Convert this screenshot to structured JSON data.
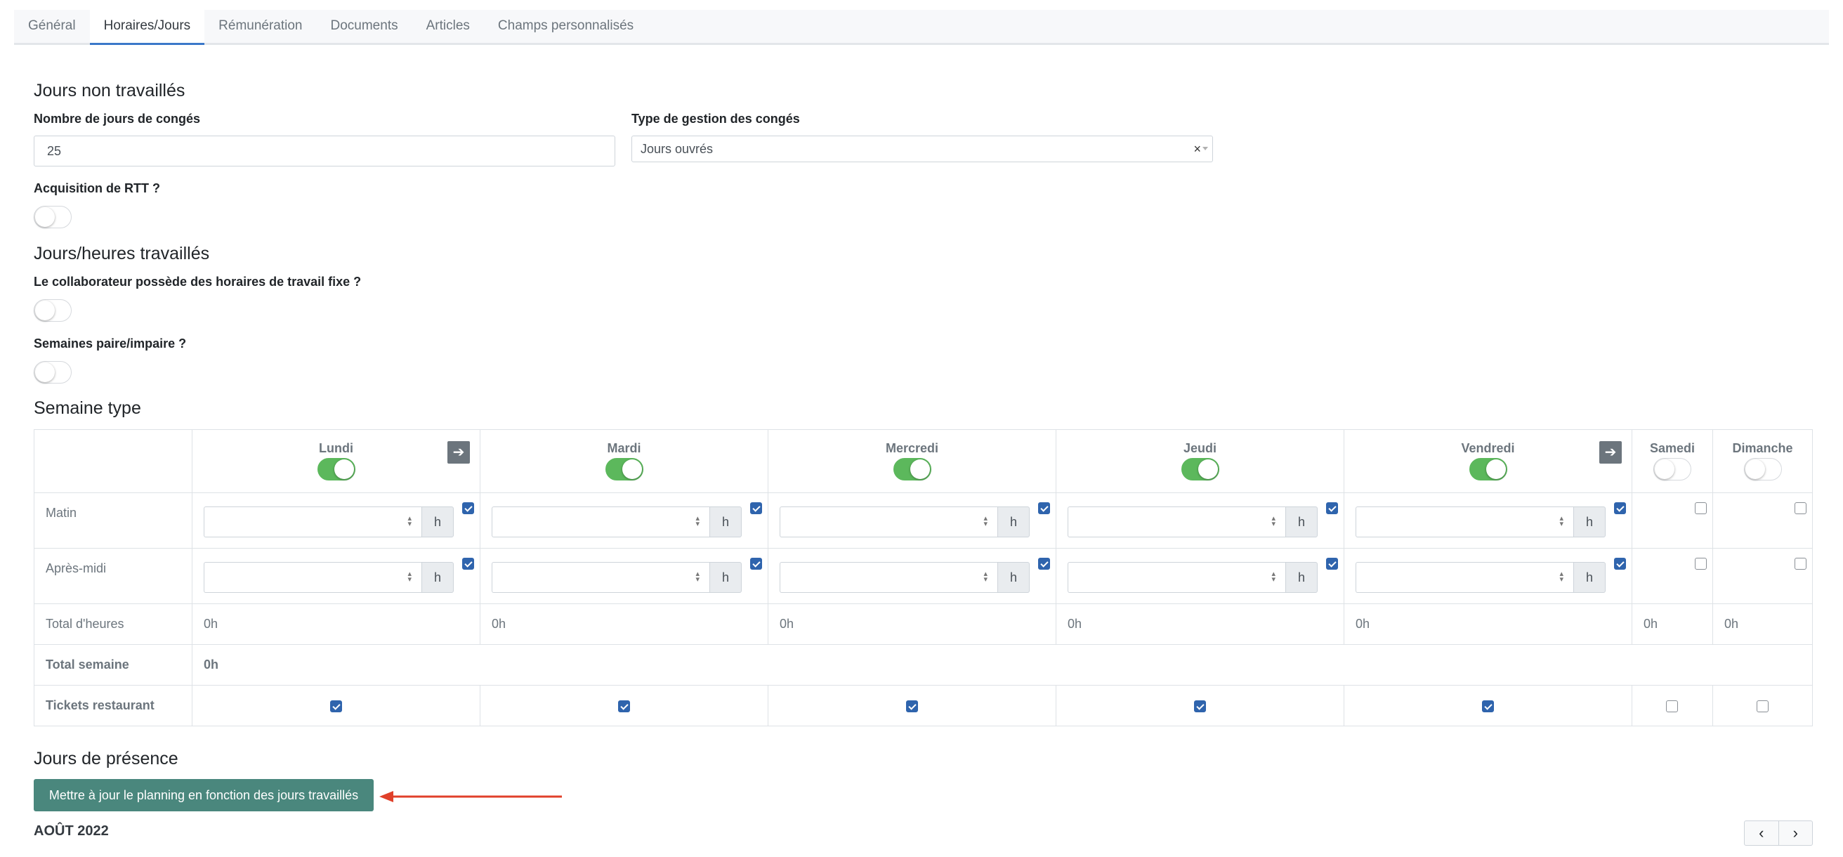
{
  "tabs": [
    {
      "label": "Général"
    },
    {
      "label": "Horaires/Jours"
    },
    {
      "label": "Rémunération"
    },
    {
      "label": "Documents"
    },
    {
      "label": "Articles"
    },
    {
      "label": "Champs personnalisés"
    }
  ],
  "active_tab": "Horaires/Jours",
  "non_worked": {
    "title": "Jours non travaillés",
    "leave_days_label": "Nombre de jours de congés",
    "leave_days_value": "25",
    "leave_type_label": "Type de gestion des congés",
    "leave_type_value": "Jours ouvrés",
    "rtt_label": "Acquisition de RTT ?",
    "rtt_on": false
  },
  "worked": {
    "title": "Jours/heures travaillés",
    "fixed_label": "Le collaborateur possède des horaires de travail fixe ?",
    "fixed_on": false,
    "even_odd_label": "Semaines paire/impaire ?",
    "even_odd_on": false
  },
  "week": {
    "title": "Semaine type",
    "days": [
      {
        "name": "Lundi",
        "on": true
      },
      {
        "name": "Mardi",
        "on": true
      },
      {
        "name": "Mercredi",
        "on": true
      },
      {
        "name": "Jeudi",
        "on": true
      },
      {
        "name": "Vendredi",
        "on": true
      },
      {
        "name": "Samedi",
        "on": false
      },
      {
        "name": "Dimanche",
        "on": false
      }
    ],
    "row_morning": "Matin",
    "row_afternoon": "Après-midi",
    "row_total_hours": "Total d'heures",
    "row_total_week": "Total semaine",
    "row_tickets": "Tickets restaurant",
    "hour_unit": "h",
    "total_hours": [
      "0h",
      "0h",
      "0h",
      "0h",
      "0h",
      "0h",
      "0h"
    ],
    "total_week": "0h",
    "tickets": [
      true,
      true,
      true,
      true,
      true,
      false,
      false
    ]
  },
  "presence": {
    "title": "Jours de présence",
    "update_button": "Mettre à jour le planning en fonction des jours travaillés",
    "month": "AOÛT 2022"
  },
  "colors": {
    "toggle_on": "#5cb85c",
    "primary_button": "#4a877d",
    "checkbox": "#2f64ad",
    "arrow": "#e0402a"
  }
}
